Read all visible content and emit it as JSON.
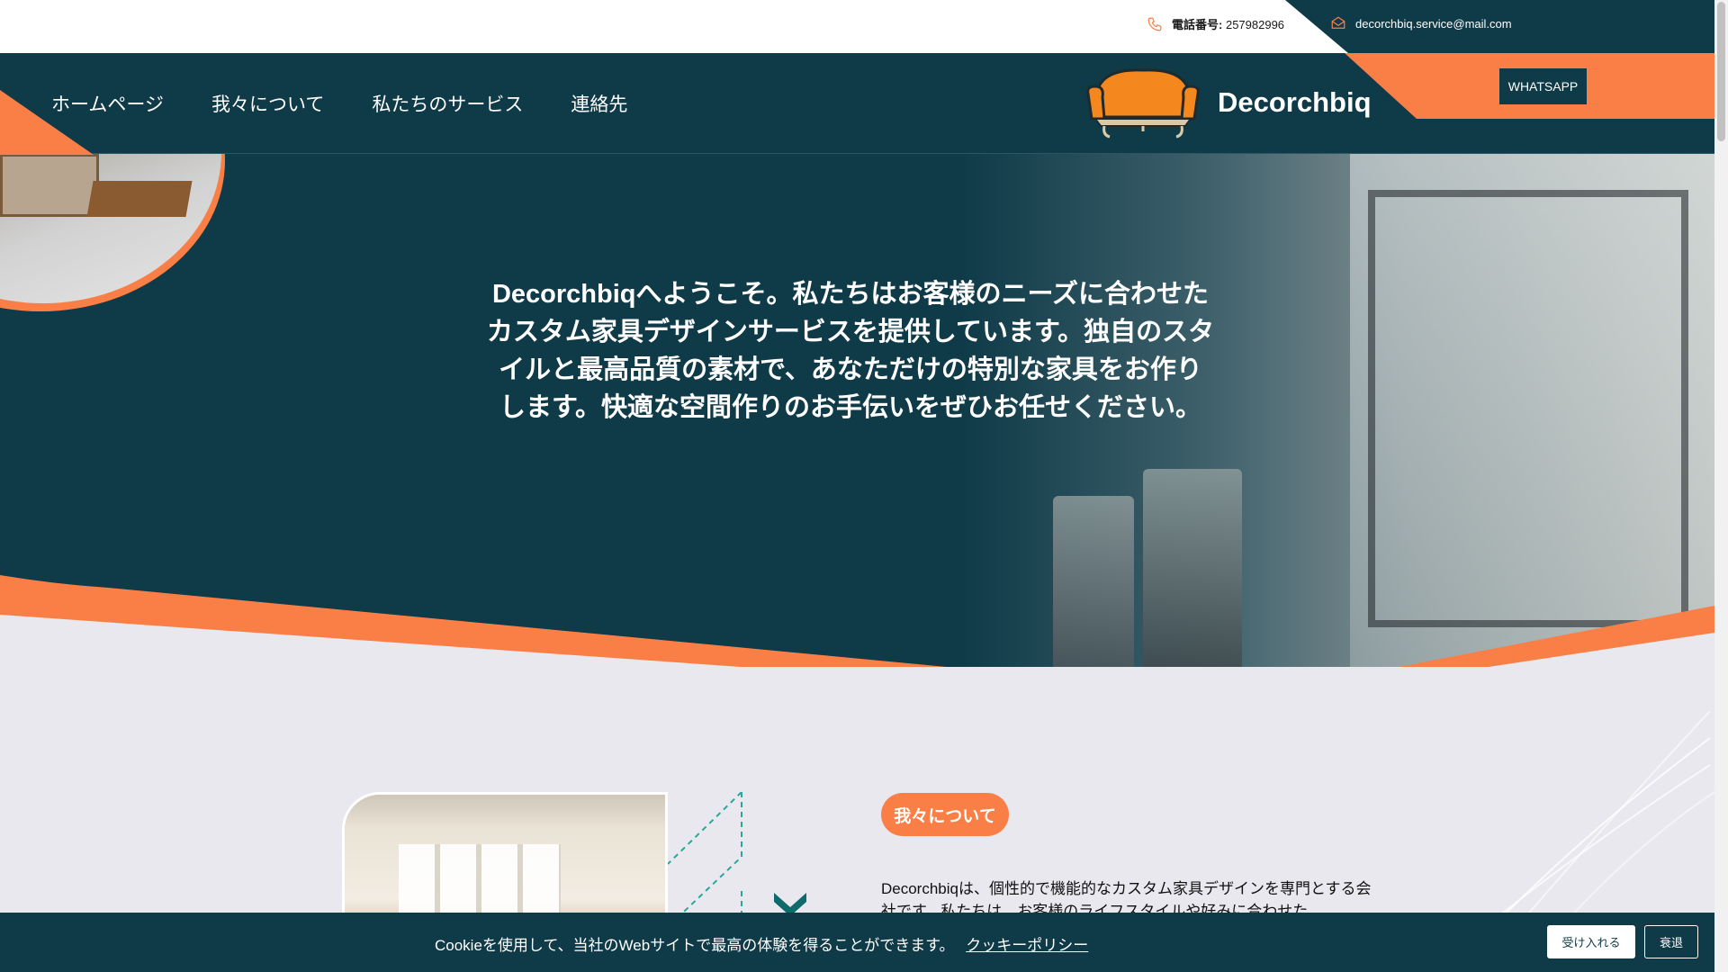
{
  "topbar": {
    "phone_label": "電話番号:",
    "phone_number": "257982996",
    "email": "decorchbiq.service@mail.com"
  },
  "nav": {
    "items": [
      {
        "label": "ホームページ"
      },
      {
        "label": "我々について"
      },
      {
        "label": "私たちのサービス"
      },
      {
        "label": "連絡先"
      }
    ]
  },
  "brand": {
    "name": "Decorchbiq"
  },
  "whatsapp_label": "WHATSAPP",
  "hero": {
    "text": "Decorchbiqへようこそ。私たちはお客様のニーズに合わせたカスタム家具デザインサービスを提供しています。独自のスタイルと最高品質の素材で、あなただけの特別な家具をお作りします。快適な空間作りのお手伝いをぜひお任せください。"
  },
  "about": {
    "badge": "我々について",
    "text": "Decorchbiqは、個性的で機能的なカスタム家具デザインを専門とする会社です。私たちは、お客様のライフスタイルや好みに合わせた"
  },
  "cookie": {
    "text": "Cookieを使用して、当社のWebサイトで最高の体験を得ることができます。",
    "link": "クッキーポリシー",
    "accept": "受け入れる",
    "reject": "衰退"
  },
  "colors": {
    "primary": "#0f3a48",
    "accent": "#fa7f46",
    "background": "#e9e8ee"
  },
  "icons": {
    "phone": "phone-icon",
    "email": "envelope-icon",
    "logo": "sofa-icon",
    "chevron": "chevron-down-icon"
  }
}
